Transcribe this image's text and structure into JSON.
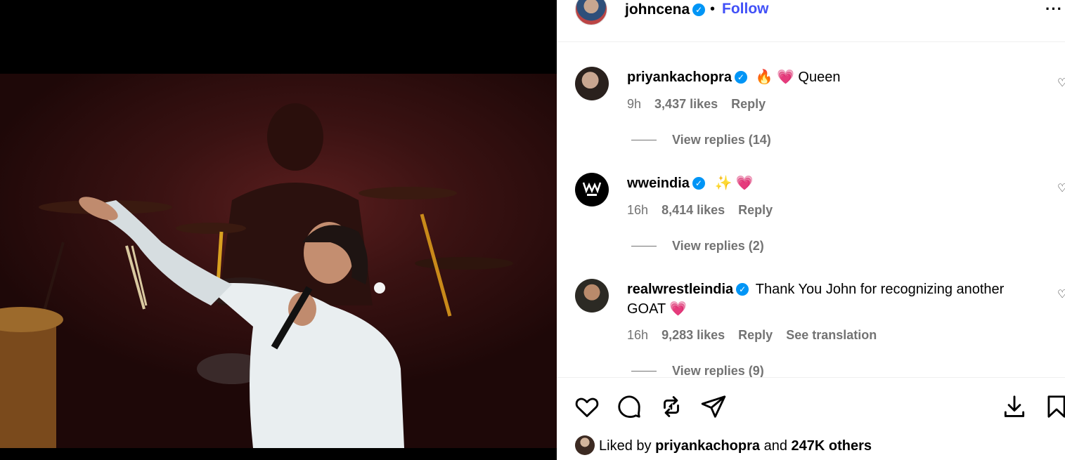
{
  "header": {
    "username": "johncena",
    "dot": "•",
    "follow_label": "Follow",
    "more_label": "···"
  },
  "comments": [
    {
      "username": "priyankachopra",
      "text": "🔥 💗 Queen",
      "time": "9h",
      "likes": "3,437 likes",
      "reply": "Reply",
      "view_replies": "View replies (14)"
    },
    {
      "username": "wweindia",
      "text": "✨ 💗",
      "time": "16h",
      "likes": "8,414 likes",
      "reply": "Reply",
      "view_replies": "View replies (2)"
    },
    {
      "username": "realwrestleindia",
      "text": "Thank You John for recognizing another GOAT 💗",
      "time": "16h",
      "likes": "9,283 likes",
      "reply": "Reply",
      "see_translation": "See translation",
      "view_replies": "View replies (9)"
    }
  ],
  "liked_by": {
    "prefix": "Liked by",
    "user": "priyankachopra",
    "and": "and",
    "others": "247K others"
  },
  "icons": {
    "verified": "verified-badge-icon",
    "like": "heart-icon",
    "comment": "comment-icon",
    "repost": "repost-icon",
    "share": "share-icon",
    "download": "download-icon",
    "save": "bookmark-icon"
  },
  "colors": {
    "follow": "#4150f7",
    "verified": "#0095f6",
    "meta": "#737373"
  }
}
